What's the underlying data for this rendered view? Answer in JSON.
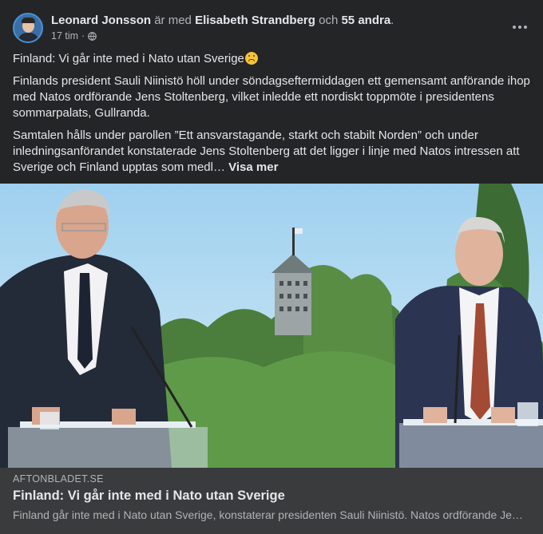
{
  "header": {
    "author": "Leonard Jonsson",
    "with_text": "är med",
    "tagged_person": "Elisabeth Strandberg",
    "and_text": "och",
    "others": "55 andra",
    "period": ".",
    "time": "17 tim",
    "separator": "·",
    "privacy_icon": "globe-icon",
    "more_icon": "more-options-icon"
  },
  "post": {
    "headline": "Finland: Vi går inte med i Nato utan Sverige",
    "headline_emoji": "upside-down-face-emoji",
    "paragraph1": "Finlands president Sauli Niinistö höll under söndagseftermiddagen ett gemensamt anförande ihop med Natos ordförande Jens Stoltenberg, vilket inledde ett nordiskt toppmöte i presidentens sommarpalats, Gullranda.",
    "paragraph2": "Samtalen hålls under parollen ”Ett ansvarstagande, starkt och stabilt Norden” och under inledningsanförandet konstaterade Jens Stoltenberg att det ligger i linje med Natos intressen att Sverige och Finland upptas som medl…",
    "see_more": "Visa mer"
  },
  "link_preview": {
    "domain": "AFTONBLADET.SE",
    "title": "Finland: Vi går inte med i Nato utan Sverige",
    "description": "Finland går inte med i Nato utan Sverige, konstaterar presidenten Sauli Niinistö. Natos ordförande Jens Stoltenberg"
  },
  "colors": {
    "background": "#18191a",
    "card": "#242526",
    "link_card": "#3a3b3c",
    "primary_text": "#e4e6eb",
    "secondary_text": "#b0b3b8"
  }
}
